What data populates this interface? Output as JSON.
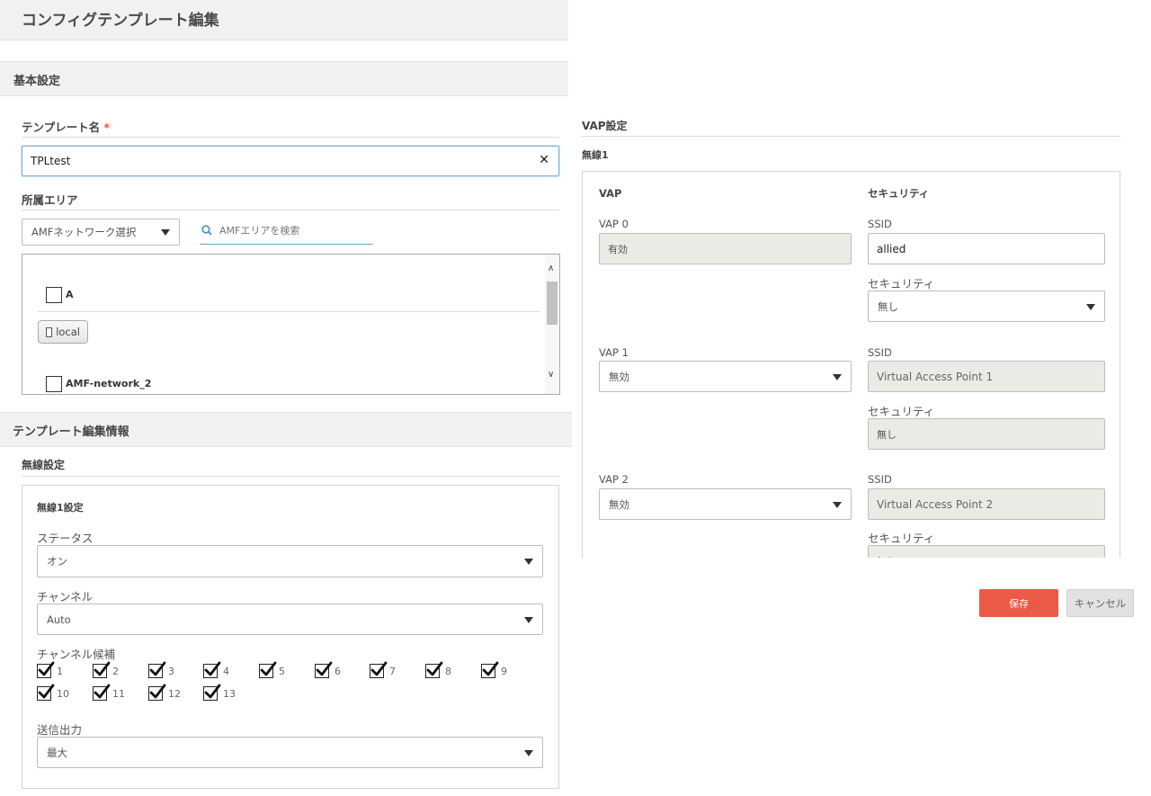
{
  "page": {
    "title": "コンフィグテンプレート編集"
  },
  "basic": {
    "section_title": "基本設定",
    "template_name_label": "テンプレート名",
    "required_mark": "*",
    "template_name_value": "TPLtest",
    "area_label": "所属エリア",
    "network_select_value": "AMFネットワーク選択",
    "search_placeholder": "AMFエリアを検索",
    "area_items": [
      {
        "label": "A",
        "checked": false
      },
      {
        "label": "local",
        "checked": false
      },
      {
        "label": "AMF-network_2",
        "checked": false
      }
    ]
  },
  "edit_info": {
    "section_title": "テンプレート編集情報",
    "wireless_label": "無線設定",
    "panel_title": "無線1設定",
    "status_label": "ステータス",
    "status_value": "オン",
    "channel_label": "チャンネル",
    "channel_value": "Auto",
    "candidates_label": "チャンネル候補",
    "channels": [
      "1",
      "2",
      "3",
      "4",
      "5",
      "6",
      "7",
      "8",
      "9",
      "10",
      "11",
      "12",
      "13"
    ],
    "tx_power_label": "送信出力",
    "tx_power_value": "最大"
  },
  "vap": {
    "section_title": "VAP設定",
    "radio_label": "無線1",
    "col_vap": "VAP",
    "col_security": "セキュリティ",
    "ssid_label": "SSID",
    "security_label": "セキュリティ",
    "rows": [
      {
        "name": "VAP 0",
        "state": "有効",
        "ssid": "allied",
        "security": "無し"
      },
      {
        "name": "VAP 1",
        "state": "無効",
        "ssid": "Virtual Access Point 1",
        "security": "無し"
      },
      {
        "name": "VAP 2",
        "state": "無効",
        "ssid": "Virtual Access Point 2",
        "security": "無し"
      }
    ]
  },
  "actions": {
    "save": "保存",
    "cancel": "キャンセル"
  },
  "colors": {
    "accent": "#ea5a45",
    "focus": "#7fb2d9",
    "section_bg": "#f1f1f1"
  }
}
